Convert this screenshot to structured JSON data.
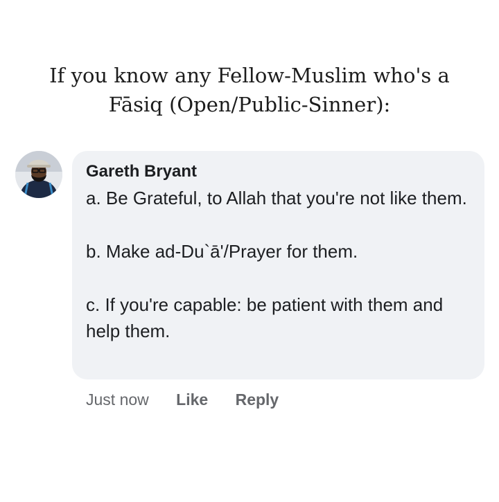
{
  "headline": {
    "line1": "If you know any Fellow-Muslim who's a",
    "line2": "Fāsiq (Open/Public-Sinner):"
  },
  "comment": {
    "author": "Gareth Bryant",
    "avatar_icon": "user-avatar-photo",
    "lines": [
      "a. Be Grateful, to Allah that you're not like them.",
      "b. Make ad-Du`ā'/Prayer for them.",
      "c. If you're capable: be patient with them and help them."
    ],
    "bubble_color": "#f0f2f5"
  },
  "actions": {
    "timestamp": "Just now",
    "like": "Like",
    "reply": "Reply",
    "color": "#65676b"
  }
}
